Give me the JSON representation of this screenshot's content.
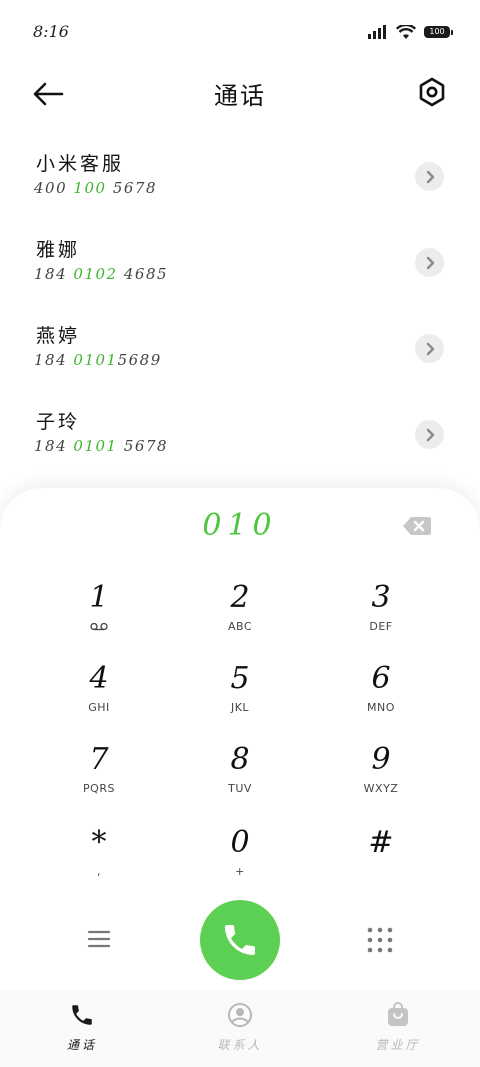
{
  "status_bar": {
    "time": "8:16",
    "battery": "100",
    "icons": [
      "signal-icon",
      "wifi-icon",
      "battery-icon"
    ]
  },
  "header": {
    "title": "通话",
    "back_icon": "arrow-left-icon",
    "settings_icon": "settings-icon"
  },
  "contacts": [
    {
      "name": "小米客服",
      "number_pre": "400 ",
      "number_hl": "100",
      "number_post": " 5678"
    },
    {
      "name": "雅娜",
      "number_pre": "184 ",
      "number_hl": "0102",
      "number_post": " 4685"
    },
    {
      "name": "燕婷",
      "number_pre": "184 ",
      "number_hl": "0101",
      "number_post": "5689"
    },
    {
      "name": "子玲",
      "number_pre": "184 ",
      "number_hl": "0101",
      "number_post": " 5678"
    }
  ],
  "dialer": {
    "input": "010",
    "keys": [
      {
        "digit": "1",
        "letters": ""
      },
      {
        "digit": "2",
        "letters": "ABC"
      },
      {
        "digit": "3",
        "letters": "DEF"
      },
      {
        "digit": "4",
        "letters": "GHI"
      },
      {
        "digit": "5",
        "letters": "JKL"
      },
      {
        "digit": "6",
        "letters": "MNO"
      },
      {
        "digit": "7",
        "letters": "PQRS"
      },
      {
        "digit": "8",
        "letters": "TUV"
      },
      {
        "digit": "9",
        "letters": "WXYZ"
      },
      {
        "digit": "*",
        "letters": ","
      },
      {
        "digit": "0",
        "letters": "+"
      },
      {
        "digit": "#",
        "letters": ""
      }
    ]
  },
  "bottom_nav": [
    {
      "label": "通话",
      "active": true
    },
    {
      "label": "联系人",
      "active": false
    },
    {
      "label": "营业厅",
      "active": false
    }
  ],
  "colors": {
    "accent_green": "#4cc63d",
    "call_button": "#5cd052",
    "inactive_nav": "#b8b8b8"
  }
}
